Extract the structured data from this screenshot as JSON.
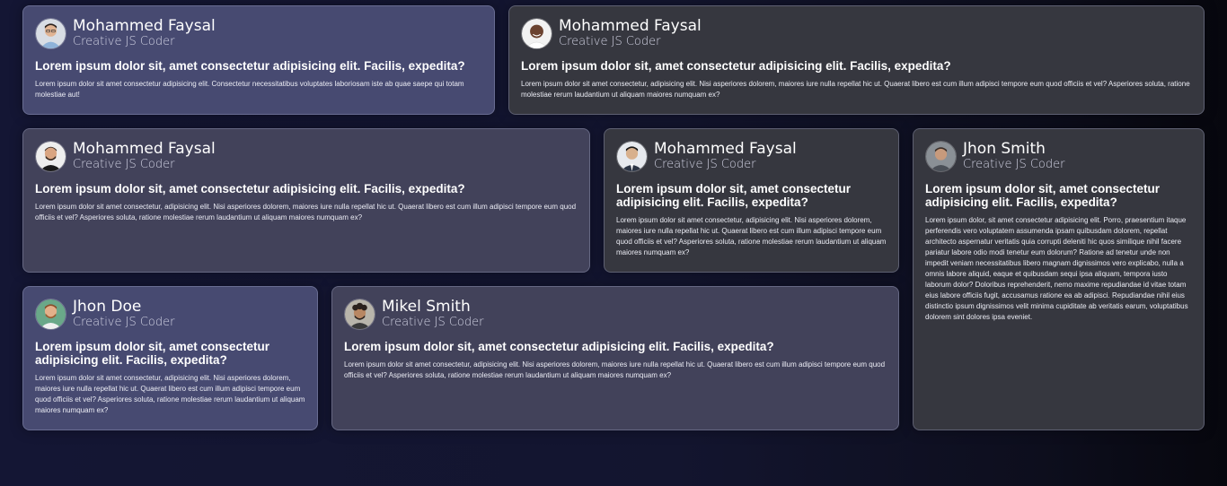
{
  "testimonials": [
    {
      "name": "Mohammed Faysal",
      "role": "Creative JS Coder",
      "avatar_icon": "avatar-man-glasses-icon",
      "headline": "Lorem ipsum dolor sit, amet consectetur adipisicing elit. Facilis, expedita?",
      "body": "Lorem ipsum dolor sit amet consectetur adipisicing elit. Consectetur necessitatibus voluptates laboriosam iste ab quae saepe qui totam molestiae aut!"
    },
    {
      "name": "Mohammed Faysal",
      "role": "Creative JS Coder",
      "avatar_icon": "avatar-man-smiling-icon",
      "headline": "Lorem ipsum dolor sit, amet consectetur adipisicing elit. Facilis, expedita?",
      "body": "Lorem ipsum dolor sit amet consectetur, adipisicing elit. Nisi asperiores dolorem, maiores iure nulla repellat hic ut. Quaerat libero est cum illum adipisci tempore eum quod officiis et vel? Asperiores soluta, ratione molestiae rerum laudantium ut aliquam maiores numquam ex?"
    },
    {
      "name": "Mohammed Faysal",
      "role": "Creative JS Coder",
      "avatar_icon": "avatar-man-beard-icon",
      "headline": "Lorem ipsum dolor sit, amet consectetur adipisicing elit. Facilis, expedita?",
      "body": "Lorem ipsum dolor sit amet consectetur, adipisicing elit. Nisi asperiores dolorem, maiores iure nulla repellat hic ut. Quaerat libero est cum illum adipisci tempore eum quod officiis et vel? Asperiores soluta, ratione molestiae rerum laudantium ut aliquam maiores numquam ex?"
    },
    {
      "name": "Mohammed Faysal",
      "role": "Creative JS Coder",
      "avatar_icon": "avatar-man-suit-icon",
      "headline": "Lorem ipsum dolor sit, amet consectetur adipisicing elit. Facilis, expedita?",
      "body": "Lorem ipsum dolor sit amet consectetur, adipisicing elit. Nisi asperiores dolorem, maiores iure nulla repellat hic ut. Quaerat libero est cum illum adipisci tempore eum quod officiis et vel? Asperiores soluta, ratione molestiae rerum laudantium ut aliquam maiores numquam ex?"
    },
    {
      "name": "Jhon Smith",
      "role": "Creative JS Coder",
      "avatar_icon": "avatar-man-short-hair-icon",
      "headline": "Lorem ipsum dolor sit, amet consectetur adipisicing elit. Facilis, expedita?",
      "body": "Lorem ipsum dolor, sit amet consectetur adipisicing elit. Porro, praesentium itaque perferendis vero voluptatem assumenda ipsam quibusdam dolorem, repellat architecto aspernatur veritatis quia corrupti deleniti hic quos similique nihil facere pariatur labore odio modi tenetur eum dolorum? Ratione ad tenetur unde non impedit veniam necessitatibus libero magnam dignissimos vero explicabo, nulla a omnis labore aliquid, eaque et quibusdam sequi ipsa aliquam, tempora iusto laborum dolor? Doloribus reprehenderit, nemo maxime repudiandae id vitae totam eius labore officiis fugit, accusamus ratione ea ab adipisci. Repudiandae nihil eius distinctio ipsum dignissimos velit minima cupiditate ab veritatis earum, voluptatibus dolorem sint dolores ipsa eveniet."
    },
    {
      "name": "Jhon Doe",
      "role": "Creative JS Coder",
      "avatar_icon": "avatar-man-red-beard-icon",
      "headline": "Lorem ipsum dolor sit, amet consectetur adipisicing elit. Facilis, expedita?",
      "body": "Lorem ipsum dolor sit amet consectetur, adipisicing elit. Nisi asperiores dolorem, maiores iure nulla repellat hic ut. Quaerat libero est cum illum adipisci tempore eum quod officiis et vel? Asperiores soluta, ratione molestiae rerum laudantium ut aliquam maiores numquam ex?"
    },
    {
      "name": "Mikel Smith",
      "role": "Creative JS Coder",
      "avatar_icon": "avatar-man-curly-hair-icon",
      "headline": "Lorem ipsum dolor sit, amet consectetur adipisicing elit. Facilis, expedita?",
      "body": "Lorem ipsum dolor sit amet consectetur, adipisicing elit. Nisi asperiores dolorem, maiores iure nulla repellat hic ut. Quaerat libero est cum illum adipisci tempore eum quod officiis et vel? Asperiores soluta, ratione molestiae rerum laudantium ut aliquam maiores numquam ex?"
    }
  ],
  "colors": {
    "card_purple": "#474a71",
    "card_mauve": "#42425a",
    "card_gray": "#36373f",
    "page_background": "#13152f"
  }
}
